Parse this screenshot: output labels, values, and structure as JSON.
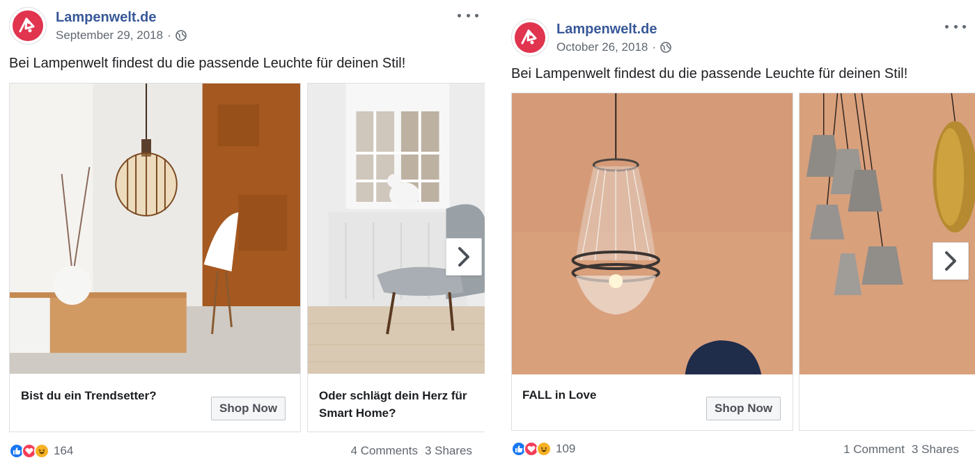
{
  "posts": [
    {
      "page_name": "Lampenwelt.de",
      "date": "September 29, 2018",
      "separator": "·",
      "caption": "Bei Lampenwelt findest du die passende Leuchte für deinen Stil!",
      "cards": [
        {
          "title": "Bist du ein Trendsetter?",
          "button": "Shop Now"
        },
        {
          "title": "Oder schlägt dein Herz für Smart Home?"
        }
      ],
      "reaction_count": "164",
      "comments": "4 Comments",
      "shares": "3 Shares"
    },
    {
      "page_name": "Lampenwelt.de",
      "date": "October 26, 2018",
      "separator": "·",
      "caption": "Bei Lampenwelt findest du die passende Leuchte für deinen Stil!",
      "cards": [
        {
          "title": "FALL in Love",
          "button": "Shop Now"
        }
      ],
      "reaction_count": "109",
      "comments": "1 Comment",
      "shares": "3 Shares"
    }
  ],
  "icons": [
    "lampenwelt-logo-icon",
    "globe-icon",
    "more-options-icon",
    "chevron-right-icon",
    "like-reaction-icon",
    "love-reaction-icon",
    "haha-reaction-icon"
  ],
  "colors": {
    "brand_red": "#e0344f",
    "link_blue": "#385898",
    "text_gray": "#606770",
    "like_blue": "#1877f2",
    "love_red": "#f33e58",
    "haha_yellow": "#f7b125"
  }
}
